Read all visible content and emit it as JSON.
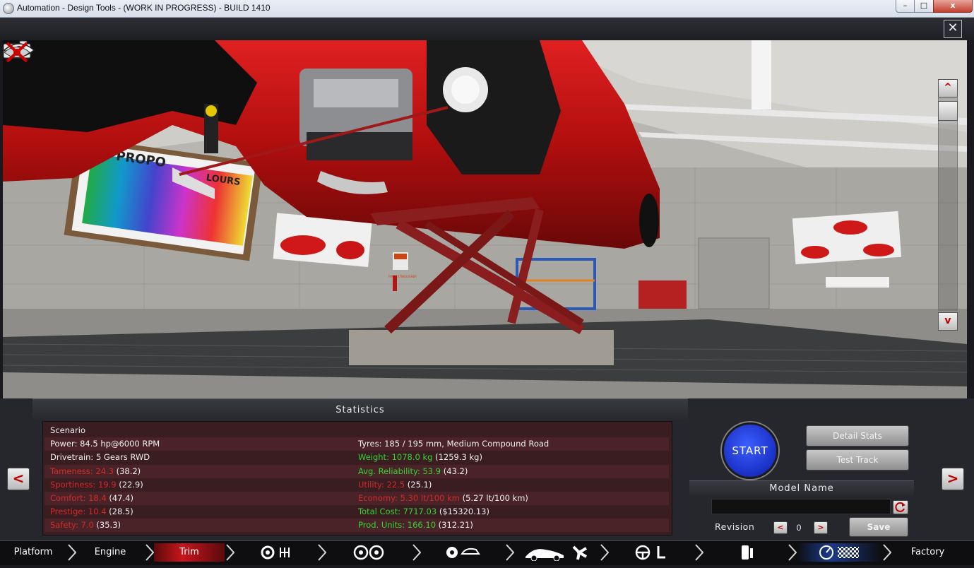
{
  "window": {
    "title": "Automation - Design Tools - (WORK IN PROGRESS) - BUILD 1410",
    "min_label": "–",
    "max_label": "□",
    "close_label": "x",
    "app_close_label": "✕"
  },
  "viewport": {
    "poster_left_text": "PROPO",
    "poster_left_text2": "LOURS",
    "sign_text": "FIRE EXTINGUISHER",
    "scroll_up_label": "^",
    "scroll_down_label": "v"
  },
  "statistics": {
    "header": "Statistics",
    "left": [
      {
        "label": "Scenario",
        "rest": "",
        "color": "white"
      },
      {
        "label": "Power: 84.5 hp@6000 RPM",
        "rest": "",
        "color": "white"
      },
      {
        "label": "Drivetrain: 5 Gears RWD",
        "rest": "",
        "color": "white"
      },
      {
        "label": "Tameness: 24.3",
        "rest": " (38.2)",
        "color": "red"
      },
      {
        "label": "Sportiness: 19.9",
        "rest": " (22.9)",
        "color": "red"
      },
      {
        "label": "Comfort: 18.4",
        "rest": " (47.4)",
        "color": "red"
      },
      {
        "label": "Prestige: 10.4",
        "rest": " (28.5)",
        "color": "red"
      },
      {
        "label": "Safety: 7.0",
        "rest": " (35.3)",
        "color": "red"
      }
    ],
    "right": [
      {
        "label": "Tyres: 185 / 195 mm, Medium Compound Road",
        "rest": "",
        "color": "white"
      },
      {
        "label": "Weight: 1078.0 kg",
        "rest": " (1259.3 kg)",
        "color": "green"
      },
      {
        "label": "Avg. Reliability: 53.9",
        "rest": " (43.2)",
        "color": "green"
      },
      {
        "label": "Utility: 22.5",
        "rest": " (25.1)",
        "color": "red"
      },
      {
        "label": "Economy: 5.30 lt/100 km",
        "rest": " (5.27 lt/100 km)",
        "color": "red"
      },
      {
        "label": "Total Cost: 7717.03",
        "rest": " ($15320.13)",
        "color": "green"
      },
      {
        "label": "Prod. Units: 166.10",
        "rest": " (312.21)",
        "color": "green"
      }
    ]
  },
  "controls": {
    "start_label": "START",
    "detail_stats_label": "Detail Stats",
    "test_track_label": "Test Track",
    "model_name_label": "Model Name",
    "model_name_value": "",
    "revision_label": "Revision",
    "revision_value": "0",
    "rev_prev_label": "<",
    "rev_next_label": ">",
    "save_label": "Save",
    "prev_label": "<",
    "next_label": ">"
  },
  "workflow": {
    "steps": [
      {
        "label": "Platform",
        "active": false
      },
      {
        "label": "Engine",
        "active": false
      },
      {
        "label": "Trim",
        "active": true
      },
      {
        "label": "",
        "icon": "gearbox-icon"
      },
      {
        "label": "",
        "icon": "wheels-icon"
      },
      {
        "label": "",
        "icon": "brakes-body-icon"
      },
      {
        "label": "",
        "icon": "aero-cooling-icon"
      },
      {
        "label": "",
        "icon": "interior-icon"
      },
      {
        "label": "",
        "icon": "fuel-system-icon"
      },
      {
        "label": "",
        "icon": "test-icon"
      },
      {
        "label": "Factory",
        "active": false
      }
    ],
    "colors": {
      "active": "#c8161c",
      "normal": "#0e0e10",
      "test": "#1a3a8a"
    }
  }
}
